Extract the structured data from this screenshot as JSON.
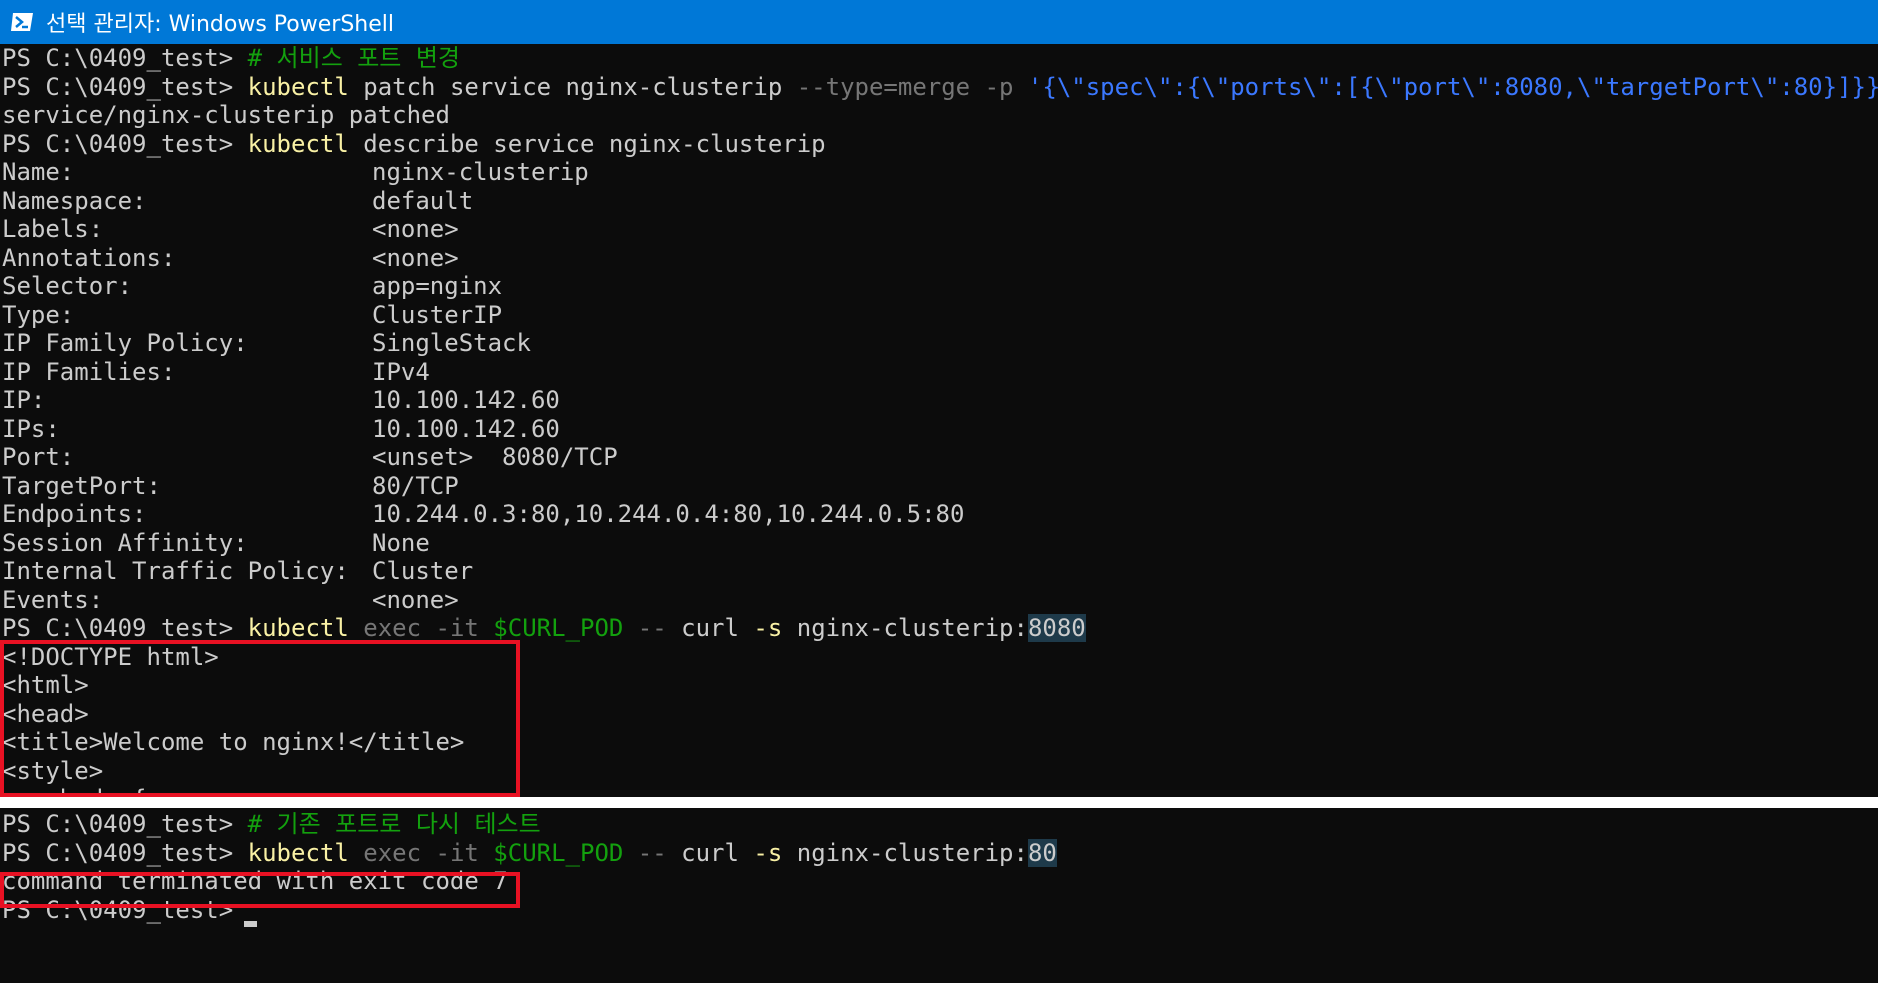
{
  "window": {
    "title": "선택 관리자: Windows PowerShell"
  },
  "colors": {
    "titlebar": "#0078d7",
    "console_bg": "#0c0c0c",
    "text": "#cccccc",
    "command": "#f9f1a5",
    "string": "#3b78ff",
    "comment": "#13a10e",
    "parameter": "#767676",
    "highlight_box": "#e81123"
  },
  "prompt": "PS C:\\0409_test> ",
  "top": {
    "l1_comment": "# 서비스 포트 변경",
    "l2_cmd": "kubectl",
    "l2_args": " patch service nginx-clusterip ",
    "l2_type": "--type=merge",
    "l2_p": " -p ",
    "l2_json": "'{\\\"spec\\\":{\\\"ports\\\":[{\\\"port\\\":8080,\\\"targetPort\\\":80}]}}'",
    "l3_output": "service/nginx-clusterip patched",
    "l4_cmd": "kubectl",
    "l4_args": " describe service nginx-clusterip",
    "describe": [
      {
        "label": "Name:",
        "value": "nginx-clusterip"
      },
      {
        "label": "Namespace:",
        "value": "default"
      },
      {
        "label": "Labels:",
        "value": "<none>"
      },
      {
        "label": "Annotations:",
        "value": "<none>"
      },
      {
        "label": "Selector:",
        "value": "app=nginx"
      },
      {
        "label": "Type:",
        "value": "ClusterIP"
      },
      {
        "label": "IP Family Policy:",
        "value": "SingleStack"
      },
      {
        "label": "IP Families:",
        "value": "IPv4"
      },
      {
        "label": "IP:",
        "value": "10.100.142.60"
      },
      {
        "label": "IPs:",
        "value": "10.100.142.60"
      },
      {
        "label": "Port:",
        "value": "<unset>  8080/TCP"
      },
      {
        "label": "TargetPort:",
        "value": "80/TCP"
      },
      {
        "label": "Endpoints:",
        "value": "10.244.0.3:80,10.244.0.4:80,10.244.0.5:80"
      },
      {
        "label": "Session Affinity:",
        "value": "None"
      },
      {
        "label": "Internal Traffic Policy:",
        "value": "Cluster"
      },
      {
        "label": "Events:",
        "value": "<none>"
      }
    ],
    "exec_cmd": "kubectl",
    "exec_flag": " exec -it ",
    "exec_var": "$CURL_POD",
    "exec_sep": " -- ",
    "exec_curl": "curl ",
    "exec_s": "-s",
    "exec_host": " nginx-clusterip:",
    "exec_port": "8080",
    "html_output": [
      "<!DOCTYPE html>",
      "<html>",
      "<head>",
      "<title>Welcome to nginx!</title>",
      "<style>",
      "    body {"
    ]
  },
  "bottom": {
    "l1_comment": "# 기존 포트로 다시 테스트",
    "exec_cmd": "kubectl",
    "exec_flag": " exec -it ",
    "exec_var": "$CURL_POD",
    "exec_sep": " -- ",
    "exec_curl": "curl ",
    "exec_s": "-s",
    "exec_host": " nginx-clusterip:",
    "exec_port": "80",
    "error": "command terminated with exit code 7"
  }
}
